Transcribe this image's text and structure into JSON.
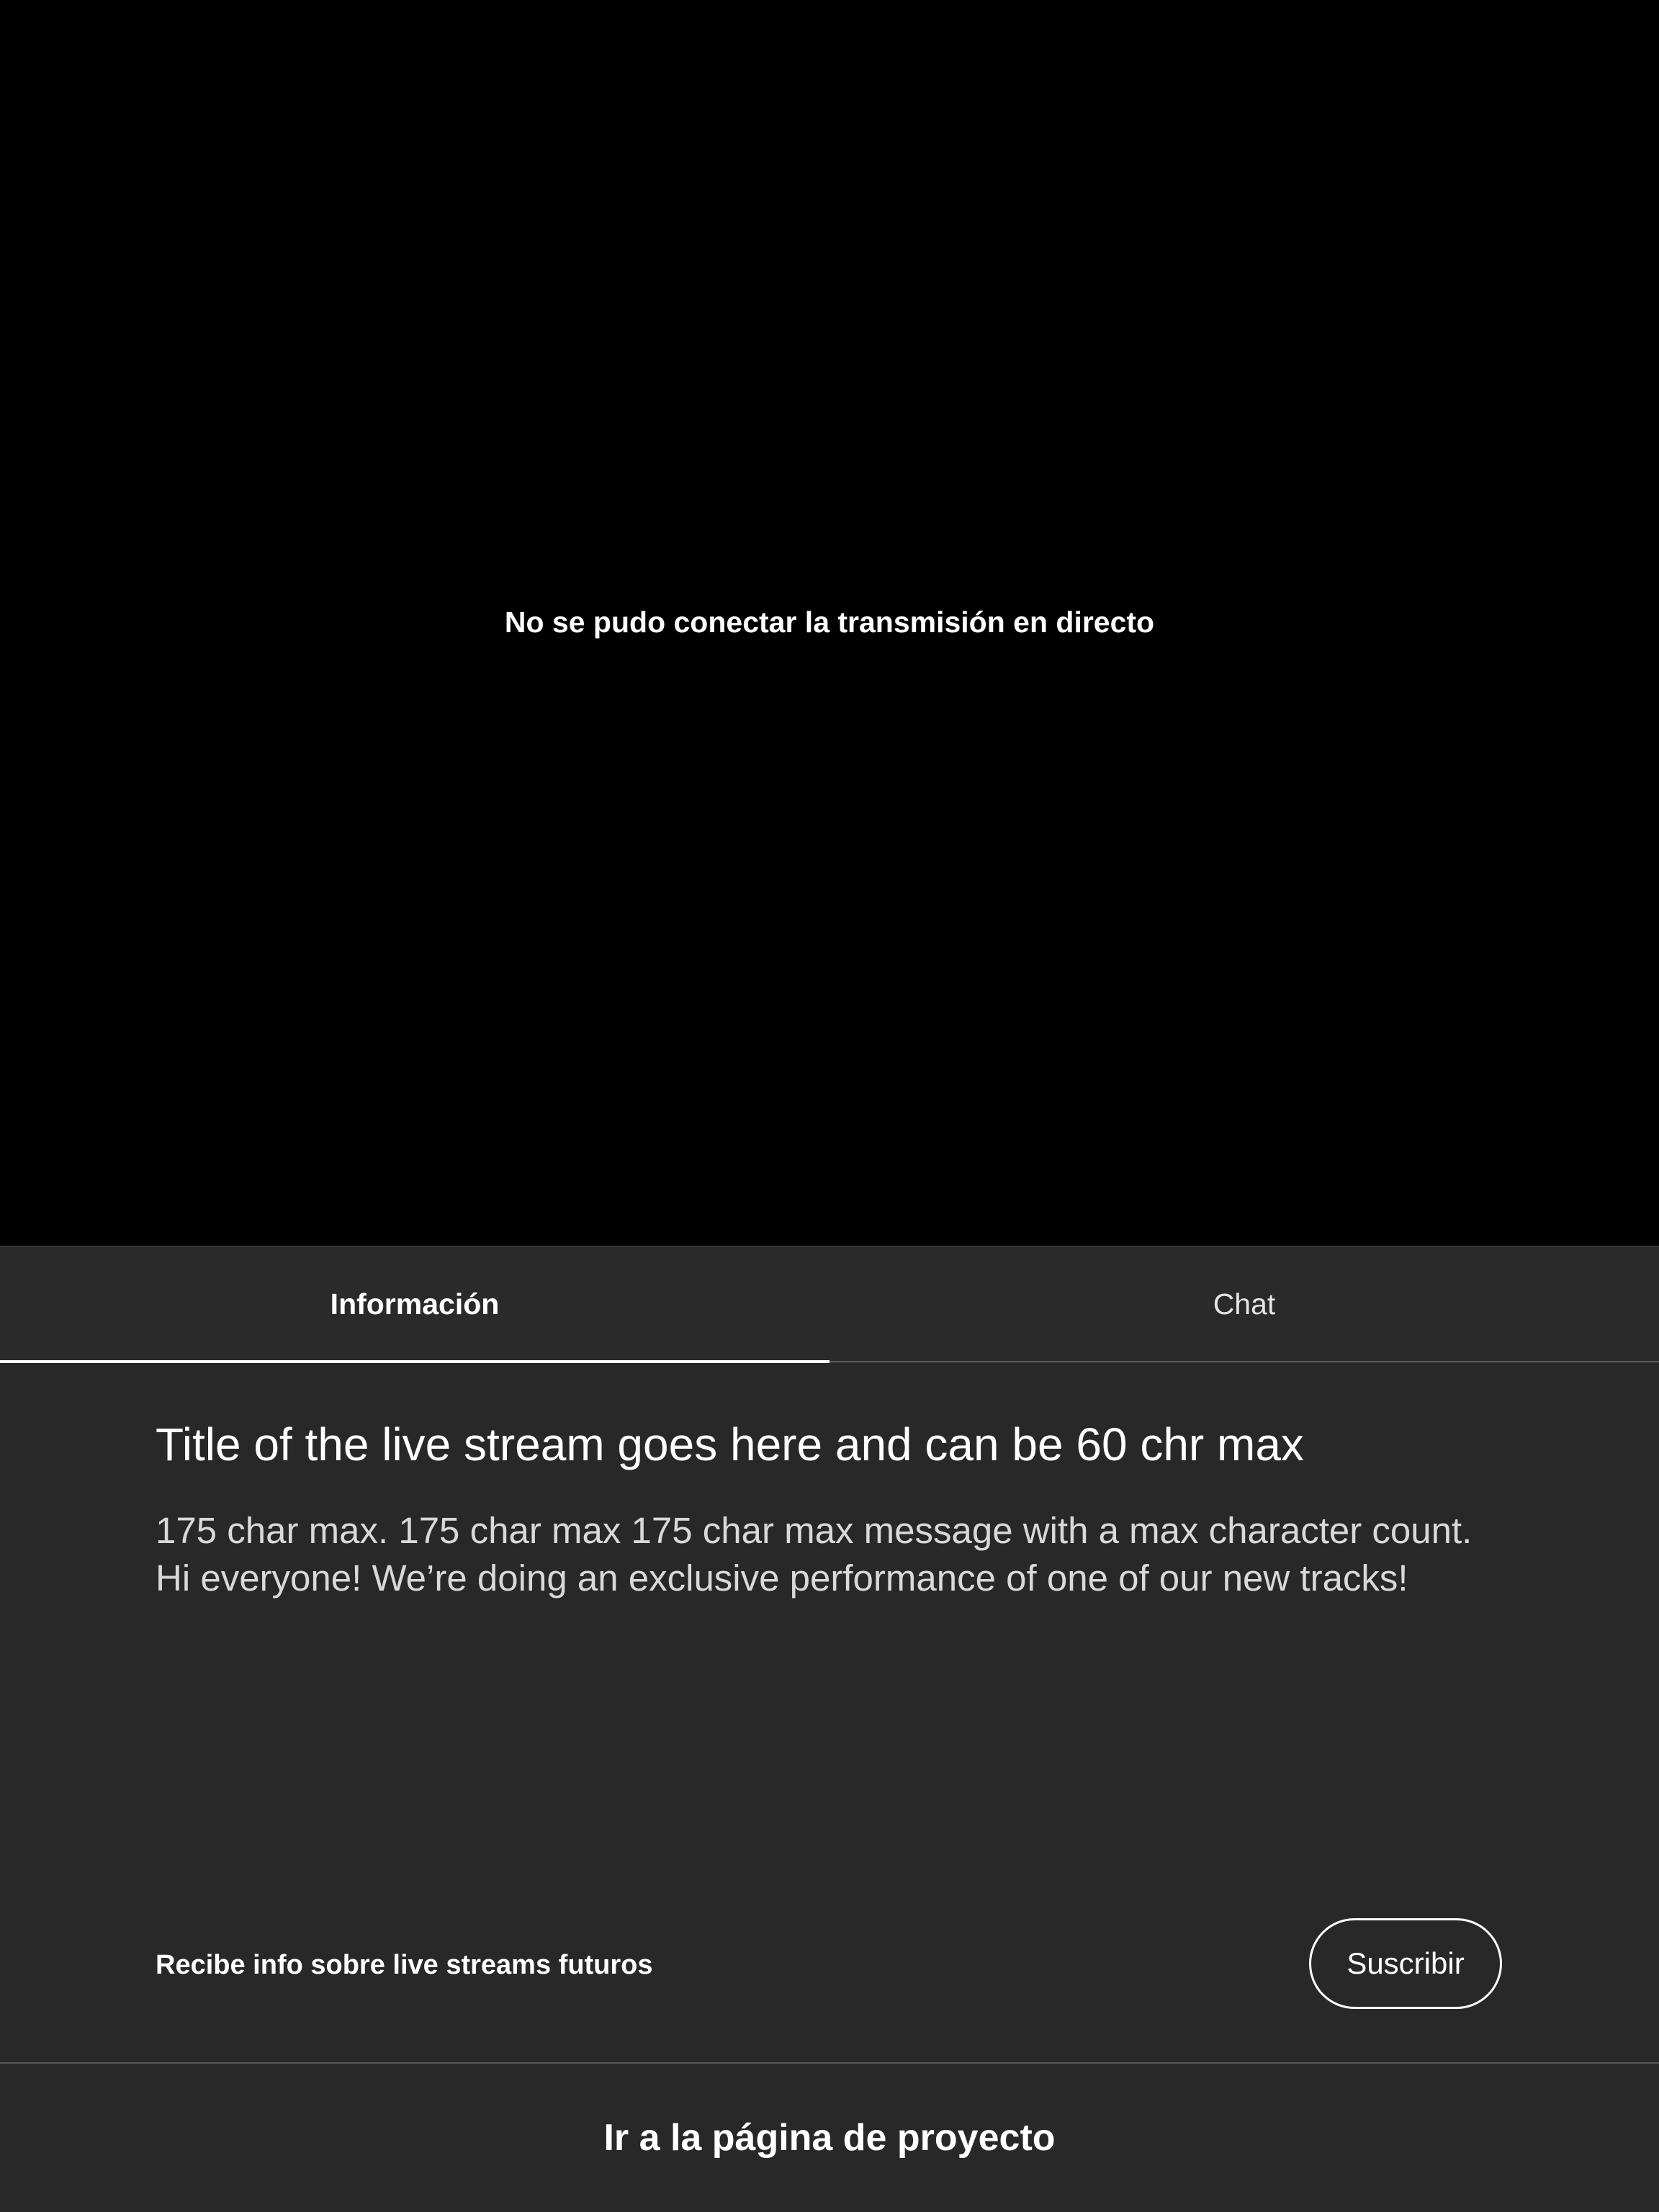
{
  "player": {
    "error_message": "No se pudo conectar la transmisión en directo"
  },
  "tabs": [
    {
      "label": "Información",
      "selected": true
    },
    {
      "label": "Chat",
      "selected": false
    }
  ],
  "stream": {
    "title": "Title of the live stream goes here and can be 60 chr max",
    "description_lines": [
      "175 char max. 175 char max 175 char max message with a max character count.",
      "Hi everyone! We’re doing an exclusive performance of one of our new tracks!"
    ]
  },
  "subscribe": {
    "label": "Recibe info sobre live streams futuros",
    "button_label": "Suscribir"
  },
  "footer": {
    "project_link_label": "Ir a la página de proyecto"
  },
  "colors": {
    "background": "#282828",
    "player_background": "#000000",
    "text_primary": "#ffffff",
    "text_secondary": "#d9d9d9",
    "divider": "#5c5c5c"
  }
}
